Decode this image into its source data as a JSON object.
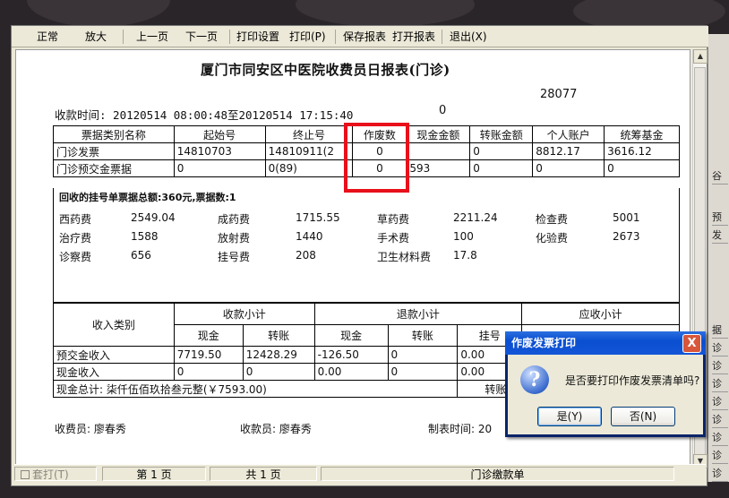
{
  "toolbar": {
    "items": [
      "正常",
      "放大",
      "上一页",
      "下一页",
      "打印设置",
      "打印(P)",
      "保存报表",
      "打开报表",
      "退出(X)"
    ]
  },
  "report": {
    "title": "厦门市同安区中医院收费员日报表(门诊)",
    "number": "28077",
    "time_label": "收款时间: 20120514  08:00:48至20120514  17:15:40",
    "time_extra": "0",
    "invoice_table": {
      "headers": [
        "票据类别名称",
        "起始号",
        "终止号",
        "作废数",
        "现金金额",
        "转账金额",
        "个人账户",
        "统筹基金"
      ],
      "rows": [
        [
          "门诊发票",
          "14810703",
          "14810911(2",
          "0",
          "",
          "0",
          "8812.17",
          "3616.12"
        ],
        [
          "门诊预交金票据",
          "0",
          "0(89)",
          "0",
          "593",
          "0",
          "0",
          "0"
        ]
      ]
    },
    "collected_note": "回收的挂号单票据总额:360元,票据数:1",
    "fee_items": [
      {
        "name": "西药费",
        "value": "2549.04"
      },
      {
        "name": "成药费",
        "value": "1715.55"
      },
      {
        "name": "草药费",
        "value": "2211.24"
      },
      {
        "name": "检查费",
        "value": "5001"
      },
      {
        "name": "治疗费",
        "value": "1588"
      },
      {
        "name": "放射费",
        "value": "1440"
      },
      {
        "name": "手术费",
        "value": "100"
      },
      {
        "name": "化验费",
        "value": "2673"
      },
      {
        "name": "诊察费",
        "value": "656"
      },
      {
        "name": "挂号费",
        "value": "208"
      },
      {
        "name": "卫生材料费",
        "value": "17.8"
      }
    ],
    "income_table": {
      "category_header": "收入类别",
      "group_headers": [
        "收款小计",
        "退款小计",
        "应收小计"
      ],
      "sub_headers": [
        "现金",
        "转账",
        "现金",
        "转账",
        "挂号"
      ],
      "rows": [
        [
          "预交金收入",
          "7719.50",
          "12428.29",
          "-126.50",
          "0",
          "0.00"
        ],
        [
          "现金收入",
          "0",
          "0",
          "0.00",
          "0",
          "0.00"
        ]
      ]
    },
    "cash_total": "现金总计: 柒仟伍佰玖拾叁元整(￥7593.00)",
    "transfer_total": "转账总计: 壹万贰",
    "cashier": "收费员: 廖春秀",
    "receiver": "收款员: 廖春秀",
    "made_time": "制表时间: 20"
  },
  "statusbar": {
    "checkbox_label": "套打(T)",
    "page_current": "第 1 页",
    "page_total": "共 1 页",
    "report_name": "门诊缴款单"
  },
  "dialog": {
    "title": "作废发票打印",
    "message": "是否要打印作废发票清单吗?",
    "yes": "是(Y)",
    "no": "否(N)",
    "close": "X"
  },
  "side_panel": {
    "cells": [
      "谷",
      "预",
      "发",
      "据",
      "诊",
      "诊",
      "诊",
      "诊",
      "诊",
      "诊",
      "诊",
      "诊"
    ]
  },
  "colors": {
    "highlight": "#e8101a",
    "dialog_title": "#0a4fd0"
  }
}
